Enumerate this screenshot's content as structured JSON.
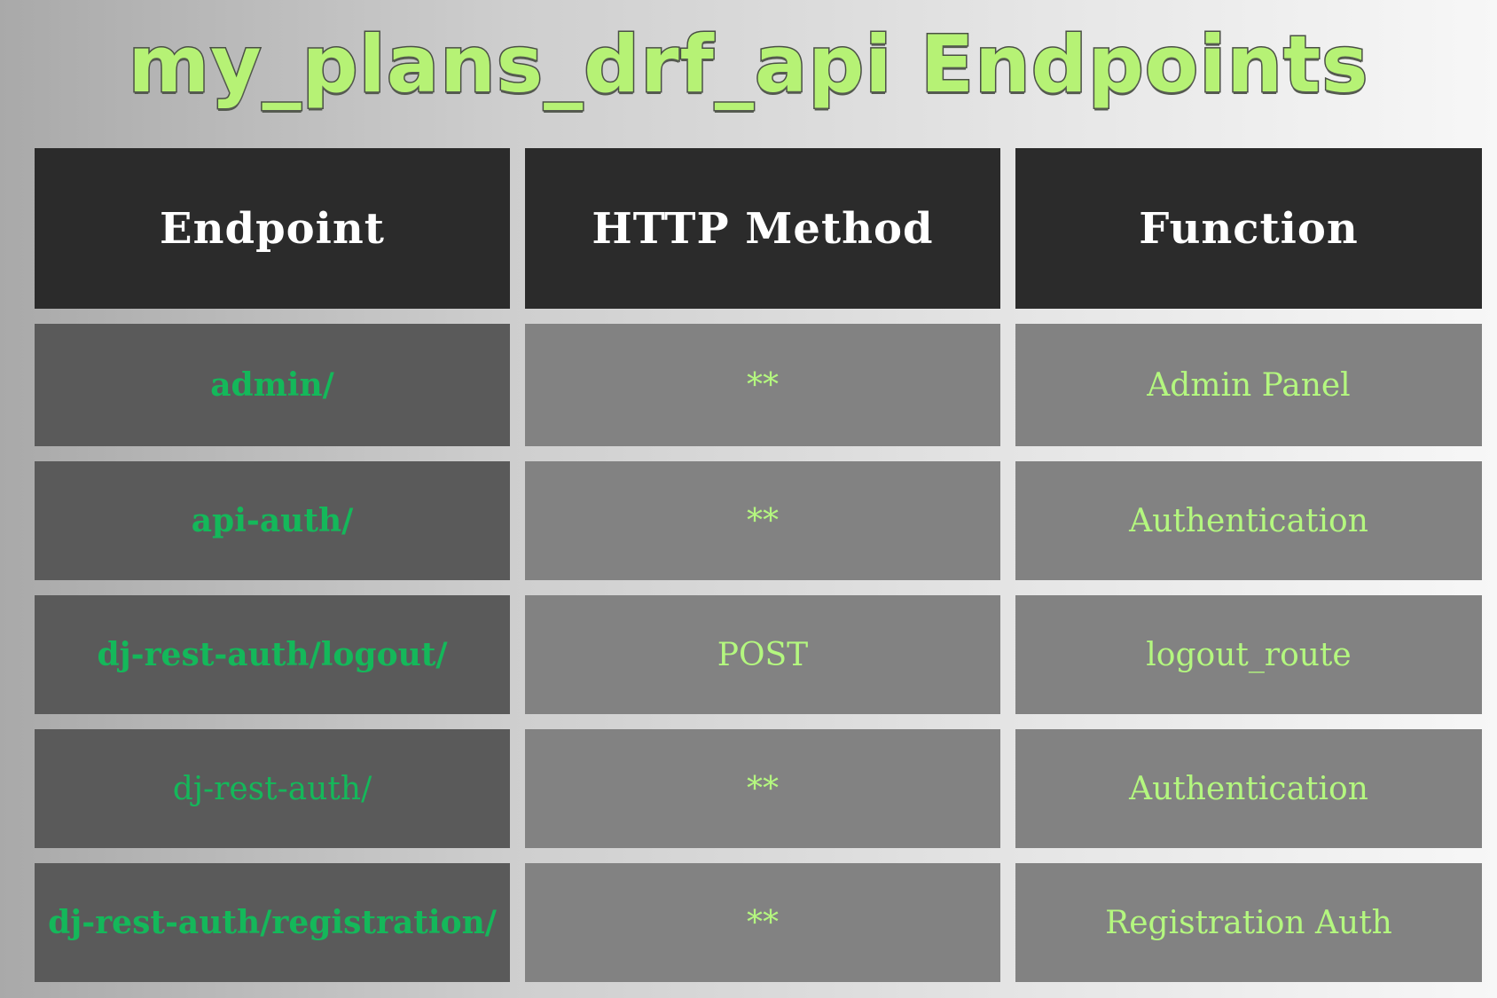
{
  "title": "my_plans_drf_api Endpoints",
  "colors": {
    "title_fill": "#b6f275",
    "header_bg": "#2b2b2b",
    "endpoint_bg": "#5a5a5a",
    "cell_bg": "#828282",
    "endpoint_text": "#14b85a",
    "value_text": "#b4f77f"
  },
  "table": {
    "headers": [
      "Endpoint",
      "HTTP Method",
      "Function"
    ],
    "rows": [
      {
        "endpoint": "admin/",
        "method": "**",
        "function": "Admin Panel"
      },
      {
        "endpoint": "api-auth/",
        "method": "**",
        "function": "Authentication"
      },
      {
        "endpoint": "dj-rest-auth/logout/",
        "method": "POST",
        "function": "logout_route"
      },
      {
        "endpoint": "dj-rest-auth/",
        "method": "**",
        "function": "Authentication"
      },
      {
        "endpoint": "dj-rest-auth/registration/",
        "method": "**",
        "function": "Registration Auth"
      }
    ]
  }
}
